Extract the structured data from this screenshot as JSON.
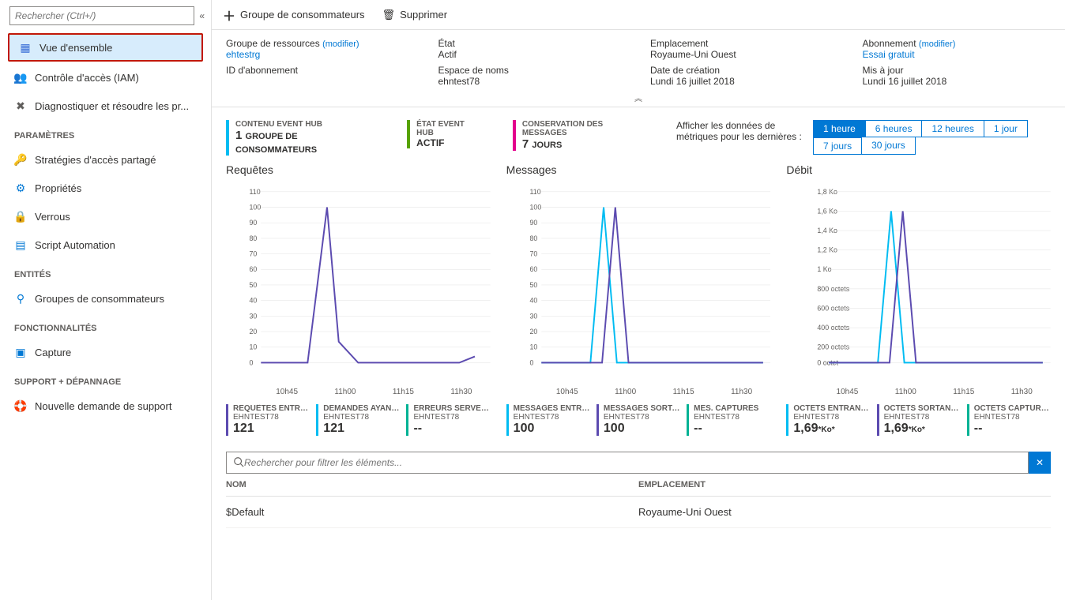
{
  "search": {
    "placeholder": "Rechercher (Ctrl+/)"
  },
  "nav": {
    "overview": "Vue d'ensemble",
    "iam": "Contrôle d'accès (IAM)",
    "diagnose": "Diagnostiquer et résoudre les pr...",
    "parametres_header": "PARAMÈTRES",
    "policies": "Stratégies d'accès partagé",
    "properties": "Propriétés",
    "locks": "Verrous",
    "script": "Script Automation",
    "entites_header": "ENTITÉS",
    "consumer_groups": "Groupes de consommateurs",
    "fonct_header": "FONCTIONNALITÉS",
    "capture": "Capture",
    "support_header": "SUPPORT + DÉPANNAGE",
    "new_support": "Nouvelle demande de support"
  },
  "toolbar": {
    "consumer_group": "Groupe de consommateurs",
    "delete": "Supprimer"
  },
  "essentials": {
    "resgroup_label": "Groupe de ressources",
    "resgroup_mod": "(modifier)",
    "resgroup_val": "ehtestrg",
    "subid_label": "ID d'abonnement",
    "state_label": "État",
    "state_val": "Actif",
    "ns_label": "Espace de noms",
    "ns_val": "ehntest78",
    "loc_label": "Emplacement",
    "loc_val": "Royaume-Uni Ouest",
    "created_label": "Date de création",
    "created_val": "Lundi 16 juillet 2018",
    "sub_label": "Abonnement",
    "sub_mod": "(modifier)",
    "sub_val": "Essai gratuit",
    "updated_label": "Mis à jour",
    "updated_val": "Lundi 16 juillet 2018"
  },
  "status": {
    "content_label": "CONTENU EVENT HUB",
    "content_val": "1",
    "content_sub": "GROUPE DE CONSOMMATEURS",
    "state_label": "ÉTAT EVENT HUB",
    "state_val": "ACTIF",
    "retention_label": "CONSERVATION DES MESSAGES",
    "retention_val": "7",
    "retention_sub": "JOURS"
  },
  "timegrain": {
    "label": "Afficher les données de métriques pour les dernières :",
    "options": [
      "1 heure",
      "6 heures",
      "12 heures",
      "1 jour",
      "7 jours",
      "30 jours"
    ],
    "selected": "1 heure"
  },
  "charts": {
    "requests": "Requêtes",
    "messages": "Messages",
    "throughput": "Débit",
    "xticks": [
      "10h45",
      "11h00",
      "11h15",
      "11h30"
    ]
  },
  "metrics": {
    "sub": "EHNTEST78",
    "req_in_label": "REQUÊTES ENTRANTES...",
    "req_in_val": "121",
    "req_ok_label": "DEMANDES AYANT RÉUSSI",
    "req_ok_val": "121",
    "req_err_label": "ERREURS SERVEUR",
    "req_err_val": "--",
    "msg_in_label": "MESSAGES ENTRANTS...",
    "msg_in_val": "100",
    "msg_out_label": "MESSAGES SORTANTS...",
    "msg_out_val": "100",
    "msg_cap_label": "MES. CAPTURÉS",
    "msg_cap_val": "--",
    "tp_in_label": "OCTETS ENTRANTS (...",
    "tp_in_val": "1,69",
    "tp_in_unit": "*Ko*",
    "tp_out_label": "OCTETS SORTANTS (...",
    "tp_out_val": "1,69",
    "tp_out_unit": "*Ko*",
    "tp_cap_label": "OCTETS CAPTURÉS",
    "tp_cap_val": "--"
  },
  "filter": {
    "placeholder": "Rechercher pour filtrer les éléments..."
  },
  "table": {
    "col_name": "NOM",
    "col_loc": "EMPLACEMENT",
    "row_name": "$Default",
    "row_loc": "Royaume-Uni Ouest"
  },
  "chart_data": [
    {
      "type": "line",
      "title": "Requêtes",
      "ylim": [
        0,
        110
      ],
      "categories": [
        "10h45",
        "10h52",
        "11h00",
        "11h03",
        "11h10",
        "11h30",
        "11h40"
      ],
      "series": [
        {
          "name": "REQUÊTES ENTRANTES (EHNTEST78)",
          "values": [
            0,
            0,
            100,
            13,
            0,
            0,
            4
          ]
        },
        {
          "name": "DEMANDES AYANT RÉUSSI (EHNTEST78)",
          "values": [
            0,
            0,
            100,
            13,
            0,
            0,
            4
          ]
        },
        {
          "name": "ERREURS SERVEUR (EHNTEST78)",
          "values": [
            0,
            0,
            0,
            0,
            0,
            0,
            0
          ]
        }
      ]
    },
    {
      "type": "line",
      "title": "Messages",
      "ylim": [
        0,
        110
      ],
      "categories": [
        "10h45",
        "10h55",
        "10h58",
        "11h00",
        "11h03",
        "11h30",
        "11h40"
      ],
      "series": [
        {
          "name": "MESSAGES ENTRANTS (EHNTEST78)",
          "values": [
            0,
            0,
            100,
            0,
            0,
            0,
            0
          ]
        },
        {
          "name": "MESSAGES SORTANTS (EHNTEST78)",
          "values": [
            0,
            0,
            0,
            100,
            0,
            0,
            0
          ]
        },
        {
          "name": "MES. CAPTURÉS (EHNTEST78)",
          "values": [
            0,
            0,
            0,
            0,
            0,
            0,
            0
          ]
        }
      ]
    },
    {
      "type": "line",
      "title": "Débit",
      "ylabel": "octets",
      "ylim": [
        0,
        1800
      ],
      "categories": [
        "10h45",
        "10h55",
        "10h58",
        "11h00",
        "11h03",
        "11h30",
        "11h40"
      ],
      "series": [
        {
          "name": "OCTETS ENTRANTS (EHNTEST78)",
          "values": [
            0,
            0,
            1600,
            0,
            0,
            0,
            0
          ]
        },
        {
          "name": "OCTETS SORTANTS (EHNTEST78)",
          "values": [
            0,
            0,
            0,
            1600,
            0,
            0,
            0
          ]
        },
        {
          "name": "OCTETS CAPTURÉS (EHNTEST78)",
          "values": [
            0,
            0,
            0,
            0,
            0,
            0,
            0
          ]
        }
      ]
    }
  ]
}
